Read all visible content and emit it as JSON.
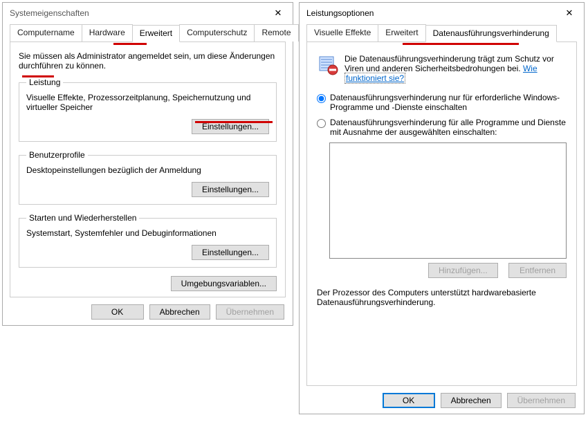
{
  "left": {
    "title": "Systemeigenschaften",
    "tabs": [
      {
        "label": "Computername"
      },
      {
        "label": "Hardware"
      },
      {
        "label": "Erweitert"
      },
      {
        "label": "Computerschutz"
      },
      {
        "label": "Remote"
      }
    ],
    "admin_note": "Sie müssen als Administrator angemeldet sein, um diese Änderungen durchführen zu können.",
    "group_performance": {
      "legend": "Leistung",
      "desc": "Visuelle Effekte, Prozessorzeitplanung, Speichernutzung und virtueller Speicher",
      "settings_btn": "Einstellungen..."
    },
    "group_profiles": {
      "legend": "Benutzerprofile",
      "desc": "Desktopeinstellungen bezüglich der Anmeldung",
      "settings_btn": "Einstellungen..."
    },
    "group_startup": {
      "legend": "Starten und Wiederherstellen",
      "desc": "Systemstart, Systemfehler und Debuginformationen",
      "settings_btn": "Einstellungen..."
    },
    "env_vars_btn": "Umgebungsvariablen...",
    "ok": "OK",
    "cancel": "Abbrechen",
    "apply": "Übernehmen"
  },
  "right": {
    "title": "Leistungsoptionen",
    "tabs": [
      {
        "label": "Visuelle Effekte"
      },
      {
        "label": "Erweitert"
      },
      {
        "label": "Datenausführungsverhinderung"
      }
    ],
    "desc_prefix": "Die Datenausführungsverhinderung trägt zum Schutz vor Viren und anderen Sicherheitsbedrohungen bei. ",
    "desc_link_lead": "Wie ",
    "desc_link_boxed": "funktioniert sie?",
    "radio_essential": "Datenausführungsverhinderung nur für erforderliche Windows-Programme und -Dienste einschalten",
    "radio_all": "Datenausführungsverhinderung für alle Programme und Dienste mit Ausnahme der ausgewählten einschalten:",
    "add_btn": "Hinzufügen...",
    "remove_btn": "Entfernen",
    "support_note": "Der Prozessor des Computers unterstützt hardwarebasierte Datenausführungsverhinderung.",
    "ok": "OK",
    "cancel": "Abbrechen",
    "apply": "Übernehmen"
  }
}
